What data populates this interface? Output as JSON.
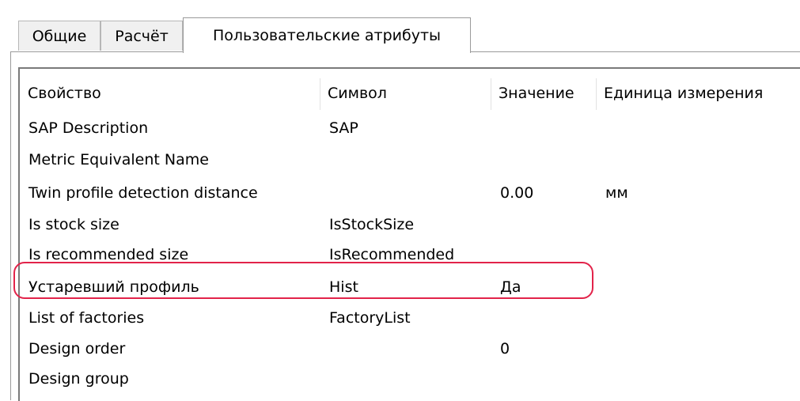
{
  "tabs": [
    {
      "label": "Общие"
    },
    {
      "label": "Расчёт"
    },
    {
      "label": "Пользовательские атрибуты"
    }
  ],
  "columns": [
    "Свойство",
    "Символ",
    "Значение",
    "Единица измерения"
  ],
  "rows": [
    {
      "property": "SAP Description",
      "symbol": "SAP",
      "value": "",
      "unit": ""
    },
    {
      "property": "Metric Equivalent Name",
      "symbol": "",
      "value": "",
      "unit": ""
    },
    {
      "property": "Twin profile detection distance",
      "symbol": "",
      "value": "0.00",
      "unit": "мм"
    },
    {
      "property": "Is stock size",
      "symbol": "IsStockSize",
      "value": "",
      "unit": ""
    },
    {
      "property": "Is recommended size",
      "symbol": "IsRecommended",
      "value": "",
      "unit": ""
    },
    {
      "property": "Устаревший профиль",
      "symbol": "Hist",
      "value": "Да",
      "unit": ""
    },
    {
      "property": "List of factories",
      "symbol": "FactoryList",
      "value": "",
      "unit": ""
    },
    {
      "property": "Design order",
      "symbol": "",
      "value": "0",
      "unit": ""
    },
    {
      "property": "Design group",
      "symbol": "",
      "value": "",
      "unit": ""
    }
  ],
  "highlight_color": "#e2234a"
}
